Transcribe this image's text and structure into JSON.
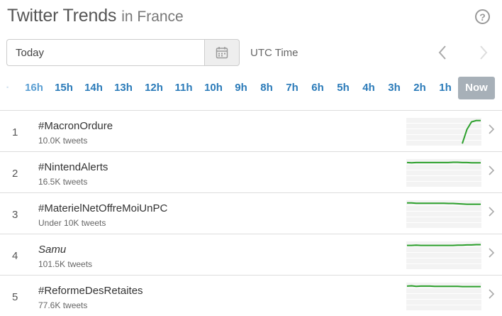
{
  "header": {
    "title": "Twitter Trends",
    "location": "in France"
  },
  "date": {
    "value": "Today",
    "utc_label": "UTC Time"
  },
  "icons": {
    "help": "question-circle-icon",
    "calendar": "calendar-icon",
    "prev": "chevron-left-icon",
    "next": "chevron-right-icon",
    "row": "chevron-right-icon"
  },
  "colors": {
    "accent": "#2b7bb9",
    "now_bg": "#a7b0b8",
    "spark": "#2ca02c"
  },
  "hours": [
    "16h",
    "15h",
    "14h",
    "13h",
    "12h",
    "11h",
    "10h",
    "9h",
    "8h",
    "7h",
    "6h",
    "5h",
    "4h",
    "3h",
    "2h",
    "1h",
    "Now"
  ],
  "trends": [
    {
      "rank": "1",
      "name": "#MacronOrdure",
      "count": "10.0K tweets",
      "italic": false,
      "spark": [
        null,
        null,
        null,
        null,
        null,
        null,
        null,
        null,
        null,
        null,
        null,
        null,
        0.05,
        0.6,
        0.9,
        0.95,
        0.95
      ]
    },
    {
      "rank": "2",
      "name": "#NintendAlerts",
      "count": "16.5K tweets",
      "italic": false,
      "spark": [
        0.92,
        0.91,
        0.92,
        0.92,
        0.92,
        0.92,
        0.92,
        0.92,
        0.92,
        0.92,
        0.93,
        0.93,
        0.92,
        0.92,
        0.91,
        0.91,
        0.91
      ]
    },
    {
      "rank": "3",
      "name": "#MaterielNetOffreMoiUnPC",
      "count": "Under 10K tweets",
      "italic": false,
      "spark": [
        0.95,
        0.95,
        0.94,
        0.94,
        0.94,
        0.94,
        0.94,
        0.94,
        0.94,
        0.93,
        0.93,
        0.92,
        0.91,
        0.9,
        0.9,
        0.9,
        0.9
      ]
    },
    {
      "rank": "4",
      "name": "Samu",
      "count": "101.5K tweets",
      "italic": true,
      "spark": [
        0.9,
        0.9,
        0.91,
        0.9,
        0.9,
        0.9,
        0.9,
        0.9,
        0.9,
        0.9,
        0.9,
        0.91,
        0.91,
        0.92,
        0.92,
        0.93,
        0.93
      ]
    },
    {
      "rank": "5",
      "name": "#ReformeDesRetaites",
      "count": "77.6K tweets",
      "italic": false,
      "spark": [
        0.92,
        0.93,
        0.91,
        0.92,
        0.92,
        0.92,
        0.91,
        0.91,
        0.91,
        0.91,
        0.91,
        0.91,
        0.9,
        0.9,
        0.9,
        0.9,
        0.9
      ]
    }
  ]
}
